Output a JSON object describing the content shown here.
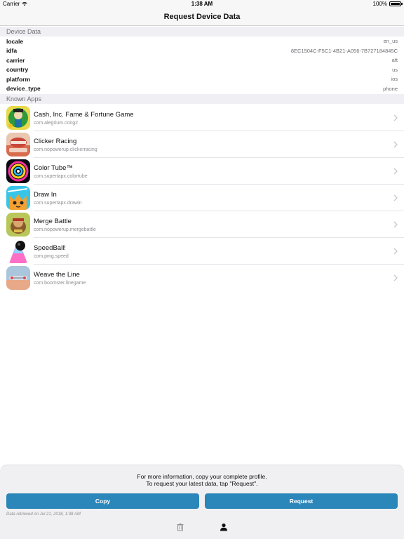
{
  "status_bar": {
    "carrier": "Carrier",
    "time": "1:38 AM",
    "battery": "100%"
  },
  "nav": {
    "title": "Request Device Data"
  },
  "device_section": {
    "header": "Device Data",
    "rows": [
      {
        "key": "locale",
        "value": "en_us"
      },
      {
        "key": "idfa",
        "value": "8EC1504C-F5C1-4B21-A056-7B727184845C"
      },
      {
        "key": "carrier",
        "value": "att"
      },
      {
        "key": "country",
        "value": "us"
      },
      {
        "key": "platform",
        "value": "ios"
      },
      {
        "key": "device_type",
        "value": "phone"
      }
    ]
  },
  "apps_section": {
    "header": "Known Apps",
    "apps": [
      {
        "name": "Cash, Inc. Fame & Fortune Game",
        "bundle": "com.alegrium.cong2",
        "icon": "cash-inc-app-icon"
      },
      {
        "name": "Clicker Racing",
        "bundle": "com.nopowerup.clickerracing",
        "icon": "clicker-racing-app-icon"
      },
      {
        "name": "Color Tube™",
        "bundle": "com.supertapx.colortube",
        "icon": "color-tube-app-icon"
      },
      {
        "name": "Draw In",
        "bundle": "com.supertapx.drawin",
        "icon": "draw-in-app-icon"
      },
      {
        "name": "Merge Battle",
        "bundle": "com.nopowerup.mergebattle",
        "icon": "merge-battle-app-icon"
      },
      {
        "name": "SpeedBall!",
        "bundle": "com.pmg.speed",
        "icon": "speedball-app-icon"
      },
      {
        "name": "Weave the Line",
        "bundle": "com.boomster.linegame",
        "icon": "weave-the-line-app-icon"
      }
    ]
  },
  "footer": {
    "info_line1": "For more information, copy your complete profile.",
    "info_line2": "To request your latest data, tap \"Request\".",
    "copy_label": "Copy",
    "request_label": "Request",
    "retrieved": "Data retrieved on Jul 21, 2018, 1:38 AM",
    "accent_color": "#2b86b9"
  }
}
